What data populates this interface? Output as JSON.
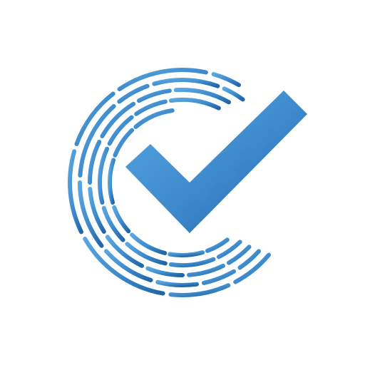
{
  "logo": {
    "icon": "checkmark-in-dashed-c-icon",
    "colors": {
      "light": "#5aa6e0",
      "mid": "#3f8dcf",
      "dark": "#2166a8"
    }
  }
}
